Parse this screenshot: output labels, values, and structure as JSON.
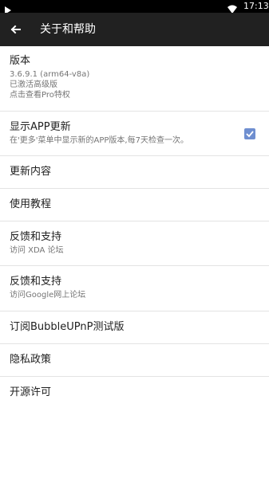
{
  "status_bar": {
    "time": "17:13"
  },
  "app_bar": {
    "title": "关于和帮助"
  },
  "items": [
    {
      "title": "版本",
      "lines": [
        "3.6.9.1 (arm64-v8a)",
        "已激活高级版",
        "点击查看Pro特权"
      ]
    },
    {
      "title": "显示APP更新",
      "subtitle": "在'更多'菜单中显示新的APP版本,每7天检查一次。",
      "checked": true
    },
    {
      "title": "更新内容"
    },
    {
      "title": "使用教程"
    },
    {
      "title": "反馈和支持",
      "subtitle": "访问 XDA 论坛"
    },
    {
      "title": "反馈和支持",
      "subtitle": "访问Google网上论坛"
    },
    {
      "title": "订阅BubbleUPnP测试版"
    },
    {
      "title": "隐私政策"
    },
    {
      "title": "开源许可"
    }
  ],
  "colors": {
    "status_bar": "#000000",
    "app_bar": "#212121",
    "accent": "#6f8fd0"
  }
}
